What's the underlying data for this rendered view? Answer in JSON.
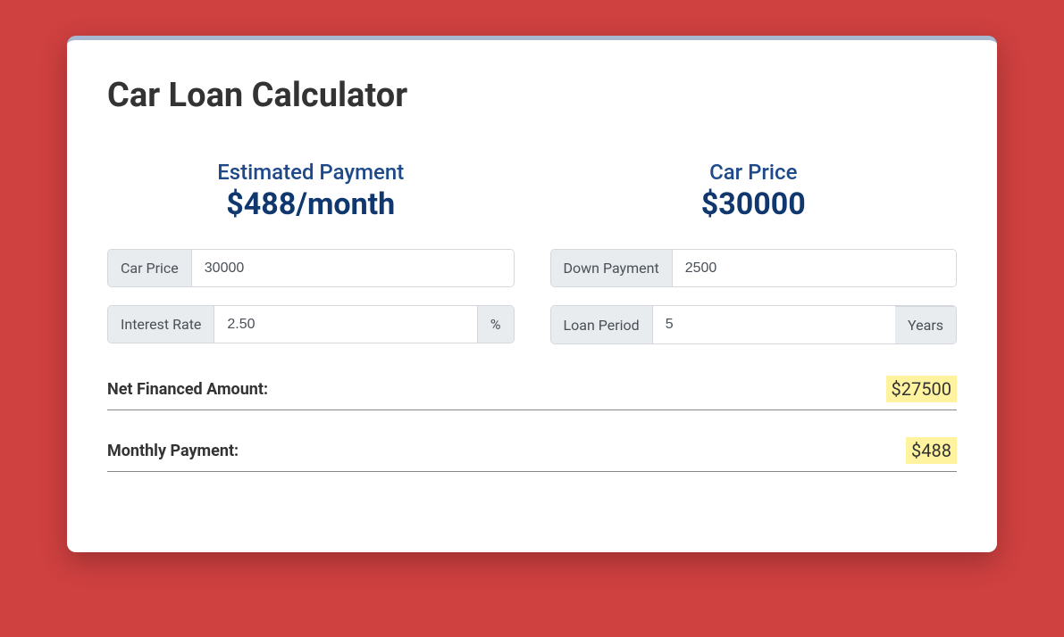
{
  "title": "Car Loan Calculator",
  "summary": {
    "estimated_payment_label": "Estimated Payment",
    "estimated_payment_value": "$488/month",
    "car_price_label": "Car Price",
    "car_price_value": "$30000"
  },
  "inputs": {
    "car_price_label": "Car Price",
    "car_price_value": "30000",
    "down_payment_label": "Down Payment",
    "down_payment_value": "2500",
    "interest_rate_label": "Interest Rate",
    "interest_rate_value": "2.50",
    "interest_rate_unit": "%",
    "loan_period_label": "Loan Period",
    "loan_period_value": "5",
    "loan_period_unit": "Years"
  },
  "results": {
    "net_financed_label": "Net Financed Amount:",
    "net_financed_value": "$27500",
    "monthly_payment_label": "Monthly Payment:",
    "monthly_payment_value": "$488"
  }
}
